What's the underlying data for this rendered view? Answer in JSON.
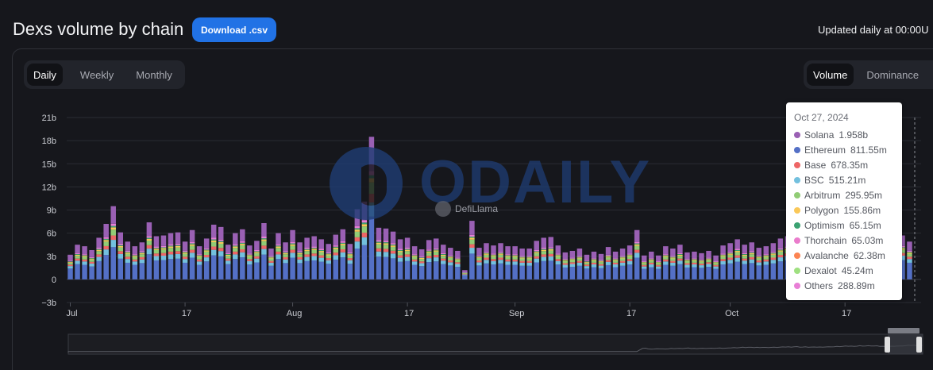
{
  "header": {
    "title": "Dexs volume by chain",
    "download_label": "Download .csv",
    "updated_note": "Updated daily at 00:00U"
  },
  "period_toggle": {
    "options": [
      "Daily",
      "Weekly",
      "Monthly"
    ],
    "selected": "Daily"
  },
  "mode_toggle": {
    "options": [
      "Volume",
      "Dominance"
    ],
    "selected": "Volume"
  },
  "watermark": {
    "brand": "ODAILY",
    "source": "DefiLlama"
  },
  "chart_data": {
    "type": "bar",
    "stacked": true,
    "ylim": [
      -3,
      21
    ],
    "y_unit": "b",
    "y_ticks": [
      {
        "value": -3,
        "label": "−3b"
      },
      {
        "value": 0,
        "label": "0"
      },
      {
        "value": 3,
        "label": "3b"
      },
      {
        "value": 6,
        "label": "6b"
      },
      {
        "value": 9,
        "label": "9b"
      },
      {
        "value": 12,
        "label": "12b"
      },
      {
        "value": 15,
        "label": "15b"
      },
      {
        "value": 18,
        "label": "18b"
      },
      {
        "value": 21,
        "label": "21b"
      }
    ],
    "x_ticks": [
      {
        "day": 0,
        "label": "Jul"
      },
      {
        "day": 16,
        "label": "17"
      },
      {
        "day": 31,
        "label": "Aug"
      },
      {
        "day": 47,
        "label": "17"
      },
      {
        "day": 62,
        "label": "Sep"
      },
      {
        "day": 78,
        "label": "17"
      },
      {
        "day": 92,
        "label": "Oct"
      },
      {
        "day": 108,
        "label": "17"
      }
    ],
    "grid": true,
    "legend": "tooltip",
    "series_order": [
      "Ethereum",
      "Solana"
    ],
    "series_colors": {
      "Ethereum": "#5470c6",
      "BSC": "#73c0de",
      "Base": "#ee6666",
      "Arbitrum": "#91cc75",
      "Polygon": "#fac858",
      "Optimism": "#3ba272",
      "Others": "#e87fd6",
      "Solana": "#9a60b4"
    },
    "series_days": {
      "note": "daily totals in billions, Jul 1 - Oct 27 2024",
      "totals": [
        3.2,
        4.5,
        4.3,
        3.8,
        5.4,
        7.2,
        9.5,
        6.1,
        4.9,
        4.3,
        4.8,
        7.4,
        5.6,
        5.7,
        6.0,
        6.1,
        4.9,
        6.4,
        4.3,
        5.3,
        7.1,
        6.8,
        4.5,
        6.0,
        6.5,
        4.4,
        5.0,
        7.3,
        4.0,
        6.0,
        4.8,
        6.4,
        4.8,
        5.4,
        5.6,
        5.2,
        4.6,
        5.8,
        6.5,
        4.6,
        9.1,
        10.1,
        18.5,
        6.7,
        6.6,
        6.2,
        5.2,
        5.4,
        4.3,
        3.9,
        5.1,
        5.3,
        4.5,
        4.1,
        3.7,
        1.2,
        7.6,
        4.1,
        4.7,
        4.4,
        4.7,
        4.3,
        4.3,
        4.0,
        4.0,
        5.0,
        5.4,
        5.5,
        4.4,
        3.5,
        3.7,
        4.0,
        3.2,
        3.6,
        3.3,
        4.2,
        3.6,
        4.0,
        4.4,
        6.4,
        3.1,
        3.6,
        3.1,
        4.3,
        4.0,
        4.5,
        3.5,
        3.6,
        3.4,
        3.7,
        3.1,
        4.4,
        4.7,
        5.2,
        4.5,
        4.8,
        4.1,
        4.3,
        4.7,
        5.3,
        5.6,
        4.3,
        3.7,
        3.6,
        3.8,
        4.1,
        4.6,
        5.5,
        5.3,
        6.0,
        5.5,
        4.9,
        3.8,
        3.6,
        3.9,
        4.7,
        5.7,
        4.9
      ],
      "last_day": {
        "date": "Oct 27, 2024",
        "breakdown": [
          {
            "name": "Solana",
            "value": 1.958,
            "label": "1.958b",
            "color": "#9a60b4"
          },
          {
            "name": "Ethereum",
            "value": 0.81155,
            "label": "811.55m",
            "color": "#5470c6"
          },
          {
            "name": "Base",
            "value": 0.67835,
            "label": "678.35m",
            "color": "#ee6666"
          },
          {
            "name": "BSC",
            "value": 0.51521,
            "label": "515.21m",
            "color": "#73c0de"
          },
          {
            "name": "Arbitrum",
            "value": 0.29595,
            "label": "295.95m",
            "color": "#91cc75"
          },
          {
            "name": "Polygon",
            "value": 0.15586,
            "label": "155.86m",
            "color": "#fac858"
          },
          {
            "name": "Optimism",
            "value": 0.06515,
            "label": "65.15m",
            "color": "#3ba272"
          },
          {
            "name": "Thorchain",
            "value": 0.06503,
            "label": "65.03m",
            "color": "#ea7ccc"
          },
          {
            "name": "Avalanche",
            "value": 0.06238,
            "label": "62.38m",
            "color": "#fc8452"
          },
          {
            "name": "Dexalot",
            "value": 0.04524,
            "label": "45.24m",
            "color": "#9fe080"
          },
          {
            "name": "Others",
            "value": 0.28889,
            "label": "288.89m",
            "color": "#e87fd6"
          }
        ]
      }
    }
  },
  "tooltip": {
    "date": "Oct 27, 2024",
    "rows": [
      {
        "name": "Solana",
        "value": "1.958b",
        "color": "#9a60b4"
      },
      {
        "name": "Ethereum",
        "value": "811.55m",
        "color": "#5470c6"
      },
      {
        "name": "Base",
        "value": "678.35m",
        "color": "#ee6666"
      },
      {
        "name": "BSC",
        "value": "515.21m",
        "color": "#73c0de"
      },
      {
        "name": "Arbitrum",
        "value": "295.95m",
        "color": "#91cc75"
      },
      {
        "name": "Polygon",
        "value": "155.86m",
        "color": "#fac858"
      },
      {
        "name": "Optimism",
        "value": "65.15m",
        "color": "#3ba272"
      },
      {
        "name": "Thorchain",
        "value": "65.03m",
        "color": "#ea7ccc"
      },
      {
        "name": "Avalanche",
        "value": "62.38m",
        "color": "#fc8452"
      },
      {
        "name": "Dexalot",
        "value": "45.24m",
        "color": "#9fe080"
      },
      {
        "name": "Others",
        "value": "288.89m",
        "color": "#e87fd6"
      }
    ]
  }
}
